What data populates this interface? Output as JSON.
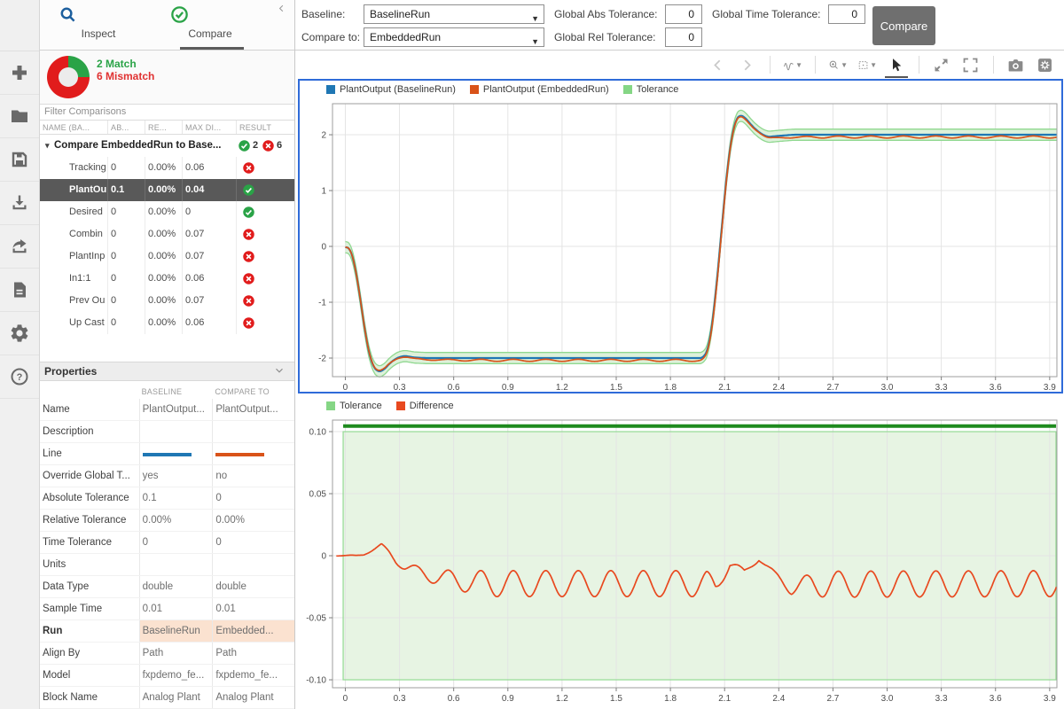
{
  "sidebar": {
    "items": [
      {
        "name": "new",
        "icon": "plus-icon"
      },
      {
        "name": "open",
        "icon": "folder-icon"
      },
      {
        "name": "save",
        "icon": "save-icon"
      },
      {
        "name": "import",
        "icon": "import-icon"
      },
      {
        "name": "export",
        "icon": "export-icon"
      },
      {
        "name": "report",
        "icon": "report-icon"
      },
      {
        "name": "preferences",
        "icon": "gear-icon"
      },
      {
        "name": "help",
        "icon": "help-icon"
      }
    ]
  },
  "tabs": {
    "inspect": "Inspect",
    "compare": "Compare",
    "selected": "Compare"
  },
  "summary": {
    "match_label": "2 Match",
    "mismatch_label": "6 Mismatch",
    "match_value": 2,
    "mismatch_value": 6
  },
  "filter": {
    "placeholder": "Filter Comparisons"
  },
  "comparison_table": {
    "columns": [
      "NAME (BA...",
      "AB...",
      "RE...",
      "MAX DI...",
      "RESULT"
    ],
    "group_row": {
      "name": "Compare EmbeddedRun to Base...",
      "match_count": "2",
      "mismatch_count": "6"
    },
    "rows": [
      {
        "name": "Tracking",
        "abs": "0",
        "rel": "0.00%",
        "max": "0.06",
        "result": "mismatch",
        "selected": false
      },
      {
        "name": "PlantOu",
        "abs": "0.1",
        "rel": "0.00%",
        "max": "0.04",
        "result": "match",
        "selected": true
      },
      {
        "name": "Desired",
        "abs": "0",
        "rel": "0.00%",
        "max": "0",
        "result": "match",
        "selected": false
      },
      {
        "name": "Combin",
        "abs": "0",
        "rel": "0.00%",
        "max": "0.07",
        "result": "mismatch",
        "selected": false
      },
      {
        "name": "PlantInp",
        "abs": "0",
        "rel": "0.00%",
        "max": "0.07",
        "result": "mismatch",
        "selected": false
      },
      {
        "name": "In1:1",
        "abs": "0",
        "rel": "0.00%",
        "max": "0.06",
        "result": "mismatch",
        "selected": false
      },
      {
        "name": "Prev Ou",
        "abs": "0",
        "rel": "0.00%",
        "max": "0.07",
        "result": "mismatch",
        "selected": false
      },
      {
        "name": "Up Cast",
        "abs": "0",
        "rel": "0.00%",
        "max": "0.06",
        "result": "mismatch",
        "selected": false
      }
    ]
  },
  "properties": {
    "title": "Properties",
    "col_headers": [
      "BASELINE",
      "COMPARE TO"
    ],
    "rows": [
      {
        "label": "Name",
        "baseline": "PlantOutput...",
        "compare": "PlantOutput..."
      },
      {
        "label": "Description",
        "baseline": "",
        "compare": ""
      },
      {
        "label": "Line",
        "type": "line",
        "baseline": "#1f77b4",
        "compare": "#d95319"
      },
      {
        "label": "Override Global T...",
        "baseline": "yes",
        "compare": "no"
      },
      {
        "label": "Absolute Tolerance",
        "baseline": "0.1",
        "compare": "0"
      },
      {
        "label": "Relative Tolerance",
        "baseline": "0.00%",
        "compare": "0.00%"
      },
      {
        "label": "Time Tolerance",
        "baseline": "0",
        "compare": "0"
      },
      {
        "label": "Units",
        "baseline": "",
        "compare": ""
      },
      {
        "label": "Data Type",
        "baseline": "double",
        "compare": "double"
      },
      {
        "label": "Sample Time",
        "baseline": "0.01",
        "compare": "0.01"
      },
      {
        "label": "Run",
        "baseline": "BaselineRun",
        "compare": "Embedded...",
        "highlight": true,
        "bold": true
      },
      {
        "label": "Align By",
        "baseline": "Path",
        "compare": "Path"
      },
      {
        "label": "Model",
        "baseline": "fxpdemo_fe...",
        "compare": "fxpdemo_fe..."
      },
      {
        "label": "Block Name",
        "baseline": "Analog Plant",
        "compare": "Analog Plant"
      }
    ]
  },
  "run_toolbar": {
    "baseline_label": "Baseline:",
    "baseline_value": "BaselineRun",
    "compare_to_label": "Compare to:",
    "compare_to_value": "EmbeddedRun",
    "abs_label": "Global Abs Tolerance:",
    "abs_value": "0",
    "rel_label": "Global Rel Tolerance:",
    "rel_value": "0",
    "time_label": "Global Time Tolerance:",
    "time_value": "0",
    "compare_button": "Compare"
  },
  "chart_toolbar": {
    "items": [
      {
        "icon": "chevron-left-icon",
        "disabled": true
      },
      {
        "icon": "chevron-right-icon",
        "disabled": true
      },
      {
        "sep": true
      },
      {
        "icon": "signal-wave-icon",
        "caret": true
      },
      {
        "sep": true
      },
      {
        "icon": "zoom-in-icon",
        "caret": true
      },
      {
        "icon": "fit-view-icon",
        "caret": true
      },
      {
        "icon": "cursor-icon",
        "selected": true
      },
      {
        "sep": true
      },
      {
        "icon": "expand-icon"
      },
      {
        "icon": "fullscreen-icon"
      },
      {
        "sep": true
      },
      {
        "icon": "camera-icon"
      },
      {
        "icon": "chart-settings-icon"
      }
    ]
  },
  "colors": {
    "accent_blue": "#2f6bd9",
    "match_green": "#2aa347",
    "mismatch_red": "#e11c1c",
    "baseline_line": "#1f77b4",
    "compare_line": "#d95319",
    "tolerance_green": "#85d685",
    "tolerance_fill": "#e0f2dc",
    "difference_red": "#e8491f",
    "match_bar_green": "#1d8a1d",
    "selection_bg": "#595959",
    "run_highlight": "#fbe2d0",
    "inspect_icon_blue": "#1d5f9e"
  },
  "chart_data": [
    {
      "id": "signal-comparison",
      "type": "line",
      "title": "",
      "legend": [
        {
          "label": "PlantOutput (BaselineRun)",
          "color": "#1f77b4"
        },
        {
          "label": "PlantOutput (EmbeddedRun)",
          "color": "#d95319"
        },
        {
          "label": "Tolerance",
          "color": "#85d685"
        }
      ],
      "xlim": [
        -0.071,
        3.94
      ],
      "ylim": [
        -2.333,
        2.556
      ],
      "grid": true,
      "xtick_values": [
        0,
        0.3,
        0.6,
        0.9,
        1.2,
        1.5,
        1.8,
        2.1,
        2.4,
        2.7,
        3.0,
        3.3,
        3.6,
        3.9
      ],
      "xtick_labels": [
        "0",
        "0.3",
        "0.6",
        "0.9",
        "1.2",
        "1.5",
        "1.8",
        "2.1",
        "2.4",
        "2.7",
        "3.0",
        "3.3",
        "3.6",
        "3.9"
      ],
      "ytick_values": [
        2,
        1,
        0,
        -1,
        -2
      ],
      "ytick_labels": [
        "2",
        "1",
        "0",
        "-1",
        "-2"
      ],
      "baseline_series": {
        "name": "PlantOutput (BaselineRun)",
        "color": "#1f77b4",
        "keypoints": [
          [
            0,
            0
          ],
          [
            0.03,
            -0.05
          ],
          [
            0.06,
            -0.45
          ],
          [
            0.09,
            -1.1
          ],
          [
            0.12,
            -1.75
          ],
          [
            0.15,
            -2.13
          ],
          [
            0.18,
            -2.25
          ],
          [
            0.21,
            -2.22
          ],
          [
            0.25,
            -2.08
          ],
          [
            0.29,
            -1.99
          ],
          [
            0.33,
            -1.96
          ],
          [
            0.38,
            -1.99
          ],
          [
            0.45,
            -2
          ],
          [
            1.2,
            -2
          ],
          [
            1.98,
            -2
          ],
          [
            2.01,
            -1.85
          ],
          [
            2.04,
            -1.2
          ],
          [
            2.07,
            -0.2
          ],
          [
            2.1,
            0.9
          ],
          [
            2.13,
            1.8
          ],
          [
            2.16,
            2.26
          ],
          [
            2.175,
            2.33
          ],
          [
            2.19,
            2.35
          ],
          [
            2.205,
            2.33
          ],
          [
            2.22,
            2.28
          ],
          [
            2.26,
            2.13
          ],
          [
            2.3,
            2.02
          ],
          [
            2.34,
            1.96
          ],
          [
            2.4,
            1.98
          ],
          [
            2.48,
            2.0
          ],
          [
            3.94,
            2.0
          ]
        ]
      },
      "compare_series": {
        "name": "PlantOutput (EmbeddedRun)",
        "color": "#d95319",
        "equals": "baseline + difference"
      },
      "tolerance_band": {
        "offset": 0.1,
        "fill": "#ddf1da",
        "edge": "#90d890"
      }
    },
    {
      "id": "difference-plot",
      "type": "line",
      "title": "",
      "legend": [
        {
          "label": "Tolerance",
          "color": "#85d685"
        },
        {
          "label": "Difference",
          "color": "#e8491f"
        }
      ],
      "xlim": [
        -0.071,
        3.94
      ],
      "ylim": [
        -0.1064,
        0.1093
      ],
      "grid": true,
      "xtick_values": [
        0,
        0.3,
        0.6,
        0.9,
        1.2,
        1.5,
        1.8,
        2.1,
        2.4,
        2.7,
        3.0,
        3.3,
        3.6,
        3.9
      ],
      "xtick_labels": [
        "0",
        "0.3",
        "0.6",
        "0.9",
        "1.2",
        "1.5",
        "1.8",
        "2.1",
        "2.4",
        "2.7",
        "3.0",
        "3.3",
        "3.6",
        "3.9"
      ],
      "ytick_values": [
        0.1,
        0.05,
        0,
        -0.05,
        -0.1
      ],
      "ytick_labels": [
        "0.10",
        "0.05",
        "0",
        "-0.05",
        "-0.10"
      ],
      "tolerance_region": {
        "t0": -0.012,
        "t1": 3.935,
        "low": -0.1,
        "high": 0.1,
        "fill": "#e7f4e3",
        "edge": "#94da94"
      },
      "match_bar": {
        "value": 0.1045,
        "t0": -0.012,
        "t1": 3.935,
        "color": "#1d8a1d",
        "thickness": 4
      },
      "difference_series": {
        "name": "Difference",
        "color": "#e8491f",
        "period": 0.18,
        "phase": 0.165,
        "t_start": -0.05,
        "t_end": 3.94,
        "envelope_keypoints": [
          [
            -0.05,
            0
          ],
          [
            0.06,
            0
          ],
          [
            0.1,
            0.001
          ],
          [
            0.15,
            0.0045
          ],
          [
            0.2,
            0.0085
          ],
          [
            0.24,
            0.003
          ],
          [
            0.28,
            -0.004
          ],
          [
            0.33,
            -0.009
          ],
          [
            0.4,
            -0.013
          ],
          [
            0.5,
            -0.017
          ],
          [
            0.62,
            -0.02
          ],
          [
            0.8,
            -0.0225
          ],
          [
            2.0,
            -0.0225
          ],
          [
            2.05,
            -0.026
          ],
          [
            2.13,
            -0.006
          ],
          [
            2.21,
            -0.0135
          ],
          [
            2.29,
            -0.002
          ],
          [
            2.38,
            -0.016
          ],
          [
            2.47,
            -0.026
          ],
          [
            2.58,
            -0.023
          ],
          [
            3.94,
            -0.0225
          ]
        ],
        "amplitude_keypoints": [
          [
            -0.05,
            0.0002
          ],
          [
            0.15,
            0.0008
          ],
          [
            0.25,
            0.0018
          ],
          [
            0.35,
            0.004
          ],
          [
            0.5,
            0.006
          ],
          [
            0.65,
            0.0085
          ],
          [
            0.8,
            0.0105
          ],
          [
            2.0,
            0.0105
          ],
          [
            2.08,
            0.005
          ],
          [
            2.2,
            0.0025
          ],
          [
            2.32,
            0.002
          ],
          [
            2.42,
            0.004
          ],
          [
            2.55,
            0.008
          ],
          [
            2.65,
            0.0105
          ],
          [
            3.94,
            0.0105
          ]
        ]
      }
    }
  ]
}
